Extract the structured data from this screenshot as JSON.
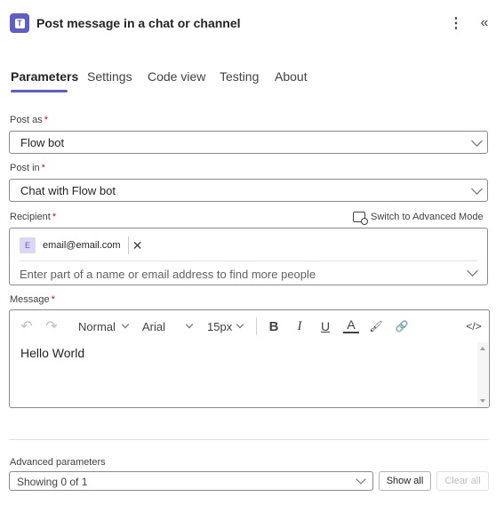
{
  "header": {
    "title": "Post message in a chat or channel",
    "app_icon_letter": "T",
    "more_glyph": "⋮",
    "collapse_glyph": "«"
  },
  "tabs": [
    {
      "label": "Parameters",
      "active": true
    },
    {
      "label": "Settings",
      "active": false
    },
    {
      "label": "Code view",
      "active": false
    },
    {
      "label": "Testing",
      "active": false
    },
    {
      "label": "About",
      "active": false
    }
  ],
  "form": {
    "post_as": {
      "label": "Post as",
      "required_mark": "*",
      "value": "Flow bot"
    },
    "post_in": {
      "label": "Post in",
      "required_mark": "*",
      "value": "Chat with Flow bot"
    },
    "recipient": {
      "label": "Recipient",
      "required_mark": "*",
      "switch_label": "Switch to Advanced Mode",
      "chip": {
        "initial": "E",
        "email": "email@email.com",
        "remove_glyph": "✕"
      },
      "placeholder": "Enter part of a name or email address to find more people"
    },
    "message": {
      "label": "Message",
      "required_mark": "*",
      "toolbar": {
        "undo_glyph": "↶",
        "redo_glyph": "↷",
        "style": "Normal",
        "font": "Arial",
        "size": "15px",
        "bold_glyph": "B",
        "italic_glyph": "I",
        "underline_glyph": "U",
        "font_color_glyph": "A",
        "highlight_glyph": "🖌",
        "link_glyph": "🔗",
        "code_glyph": "</>"
      },
      "body": "Hello World"
    }
  },
  "advanced": {
    "label": "Advanced parameters",
    "value": "Showing 0 of 1",
    "show_all": "Show all",
    "clear_all": "Clear all"
  },
  "colors": {
    "accent": "#5b5fc7",
    "required": "#c50f1f",
    "border": "#8a8a8a"
  }
}
